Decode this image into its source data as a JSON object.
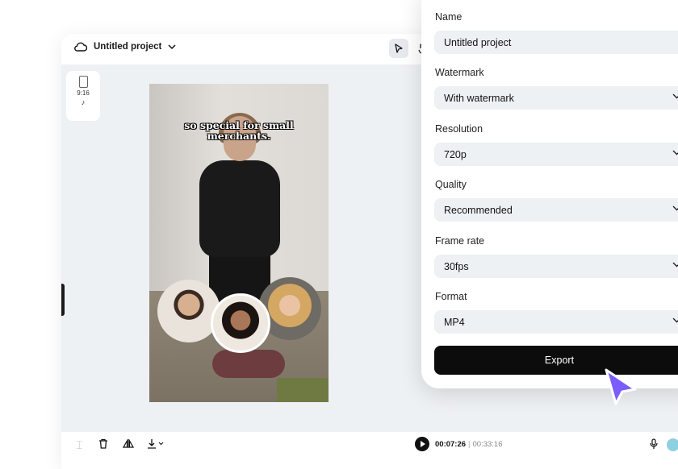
{
  "topbar": {
    "project_title": "Untitled project"
  },
  "ratio": {
    "label": "9:16",
    "platform_icon": "tiktok-icon"
  },
  "video": {
    "caption": "so special for small merchants."
  },
  "playback": {
    "current_time": "00:07:26",
    "separator": "|",
    "total_time": "00:33:16"
  },
  "export_panel": {
    "name": {
      "label": "Name",
      "value": "Untitled project"
    },
    "watermark": {
      "label": "Watermark",
      "value": "With watermark"
    },
    "resolution": {
      "label": "Resolution",
      "value": "720p"
    },
    "quality": {
      "label": "Quality",
      "value": "Recommended"
    },
    "frame_rate": {
      "label": "Frame rate",
      "value": "30fps"
    },
    "format": {
      "label": "Format",
      "value": "MP4"
    },
    "export_label": "Export"
  },
  "colors": {
    "accent_cursor": "#7b5cff",
    "button_bg": "#0c0c0c",
    "field_bg": "#eef1f4"
  }
}
